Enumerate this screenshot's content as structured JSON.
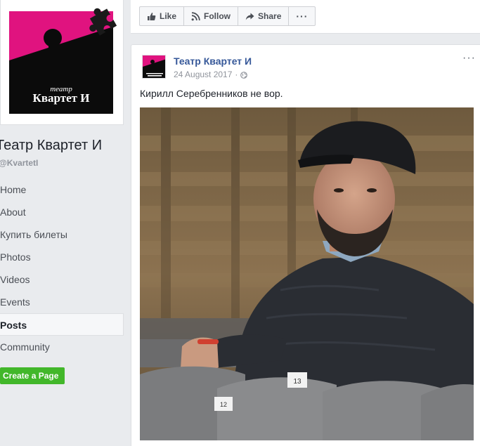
{
  "page": {
    "name": "Театр Квартет И",
    "handle": "@KvartetI",
    "logo": {
      "small_text": "театр",
      "big_text": "Квартет И",
      "colors": {
        "magenta": "#e0137f",
        "black": "#0b0b0b"
      }
    }
  },
  "nav": {
    "items": [
      {
        "label": "Home",
        "active": false
      },
      {
        "label": "About",
        "active": false
      },
      {
        "label": "Купить билеты",
        "active": false
      },
      {
        "label": "Photos",
        "active": false
      },
      {
        "label": "Videos",
        "active": false
      },
      {
        "label": "Events",
        "active": false
      },
      {
        "label": "Posts",
        "active": true
      },
      {
        "label": "Community",
        "active": false
      }
    ],
    "create_page_label": "Create a Page"
  },
  "actions": {
    "like": {
      "label": "Like",
      "icon": "thumbs-up-icon"
    },
    "follow": {
      "label": "Follow",
      "icon": "rss-icon"
    },
    "share": {
      "label": "Share",
      "icon": "share-arrow-icon"
    },
    "more": {
      "label": "···",
      "icon": "more-dots-icon"
    }
  },
  "post": {
    "author": "Театр Квартет И",
    "date": "24 August 2017",
    "separator": "·",
    "privacy_icon": "globe-icon",
    "menu_label": "···",
    "text": "Кирилл Серебренников не вор.",
    "photo_seat_numbers": [
      "13",
      "12"
    ]
  },
  "colors": {
    "link_blue": "#365899",
    "green_button": "#42b72a",
    "page_bg": "#e9ebee"
  }
}
